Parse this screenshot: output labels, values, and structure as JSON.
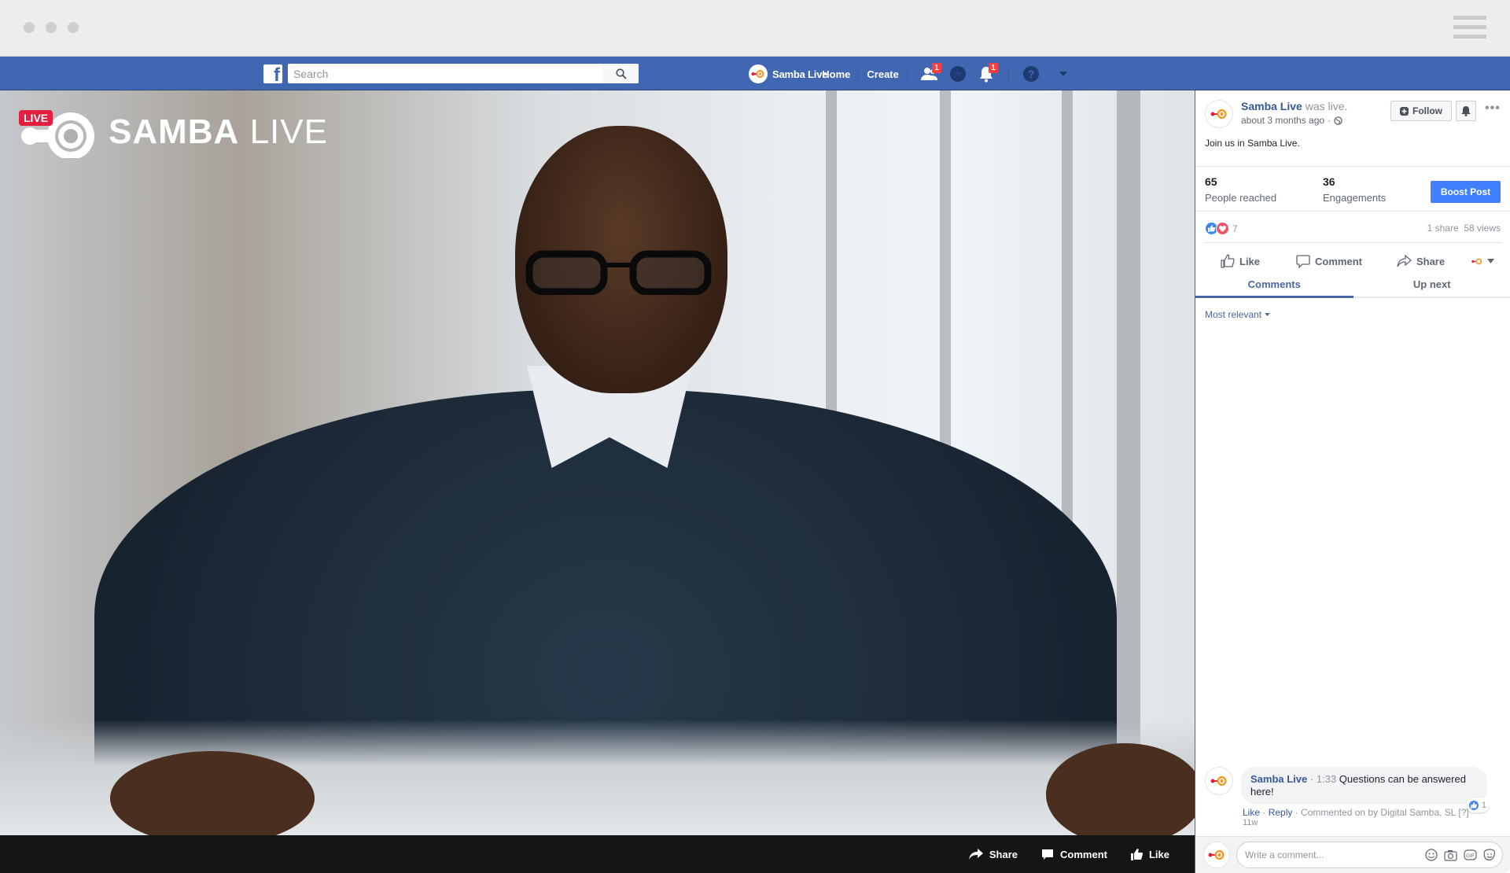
{
  "window": {
    "controls": [
      "close",
      "minimize",
      "maximize"
    ],
    "menu_icon": "hamburger-icon"
  },
  "nav": {
    "logo_icon": "facebook-logo-icon",
    "search": {
      "placeholder": "Search",
      "value": "",
      "button_icon": "search-icon"
    },
    "profile_name": "Samba Live",
    "home_label": "Home",
    "create_label": "Create",
    "friend_requests_badge": "1",
    "notifications_badge": "1",
    "icons": [
      "friends-icon",
      "messenger-icon",
      "notifications-icon",
      "help-icon",
      "account-menu-icon"
    ]
  },
  "video": {
    "live_label": "LIVE",
    "brand_bold": "SAMBA",
    "brand_light": "LIVE",
    "bar": {
      "share_label": "Share",
      "comment_label": "Comment",
      "like_label": "Like"
    }
  },
  "post": {
    "author": "Samba Live",
    "action": "was live.",
    "time": "about 3 months ago",
    "privacy_icon": "globe-icon",
    "follow_label": "Follow",
    "text": "Join us in Samba Live.",
    "stats": {
      "people_reached": "65",
      "people_reached_label": "People reached",
      "engagements": "36",
      "engagements_label": "Engagements"
    },
    "boost_label": "Boost Post",
    "reactions_count": "7",
    "shares": "1 share",
    "views": "58 views",
    "actions": {
      "like": "Like",
      "comment": "Comment",
      "share": "Share"
    },
    "tabs": [
      {
        "label": "Comments",
        "active": true
      },
      {
        "label": "Up next",
        "active": false
      }
    ],
    "sort_label": "Most relevant"
  },
  "comments": [
    {
      "author": "Samba Live",
      "time": "1:33",
      "text": "Questions can be answered here!",
      "likes": "1",
      "like_label": "Like",
      "reply_label": "Reply",
      "note": "Commented on by Digital Samba, SL [?]",
      "age": "11w"
    }
  ],
  "composer": {
    "placeholder": "Write a comment...",
    "icons": [
      "emoji-icon",
      "camera-icon",
      "gif-icon",
      "sticker-icon"
    ]
  },
  "colors": {
    "brand_blue": "#4267b2",
    "boost_blue": "#4080ff",
    "live_red": "#e41e3f",
    "link_blue": "#365899",
    "samba_orange": "#f7931e"
  }
}
